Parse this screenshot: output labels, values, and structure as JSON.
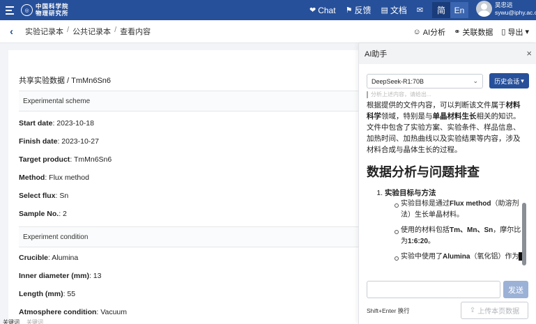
{
  "header": {
    "logo_text_line1": "中国科学院",
    "logo_text_line2": "物理研究所",
    "nav": [
      {
        "icon": "chat-icon",
        "glyph": "❤",
        "label": "Chat"
      },
      {
        "icon": "feedback-icon",
        "glyph": "⚑",
        "label": "反馈"
      },
      {
        "icon": "document-icon",
        "glyph": "▤",
        "label": "文档"
      },
      {
        "icon": "mail-icon",
        "glyph": "✉",
        "label": ""
      }
    ],
    "lang_simplified": "简",
    "lang_english": "En",
    "user_name": "吴忠远",
    "user_email": "sywu@iphy.ac.c"
  },
  "breadcrumb": {
    "items": [
      "实验记录本",
      "公共记录本",
      "查看内容"
    ],
    "separator": "/"
  },
  "actions": {
    "ai_analysis": "AI分析",
    "link_data": "关联数据",
    "export": "导出"
  },
  "document": {
    "title": "共享实验数据 / TmMn6Sn6",
    "section1": "Experimental scheme",
    "fields1": [
      {
        "label": "Start date",
        "value": ": 2023-10-18"
      },
      {
        "label": "Finish date",
        "value": ": 2023-10-27"
      },
      {
        "label": "Target product",
        "value": ": TmMn6Sn6"
      },
      {
        "label": "Method",
        "value": ": Flux method"
      },
      {
        "label": "Select flux",
        "value": ": Sn"
      },
      {
        "label": "Sample No.",
        "value": ": 2"
      }
    ],
    "section2": "Experiment condition",
    "fields2": [
      {
        "label": "Crucible",
        "value": ": Alumina"
      },
      {
        "label": "Inner diameter (mm)",
        "value": ": 13"
      },
      {
        "label": "Length (mm)",
        "value": ": 55"
      },
      {
        "label": "Atmosphere condition",
        "value": ": Vacuum"
      }
    ]
  },
  "bottom_tabs": [
    "关键词",
    "关键词"
  ],
  "ai_panel": {
    "title": "AI助手",
    "close": "×",
    "model": "DeepSeek-R1:70B",
    "history_button": "历史会话",
    "quote_text": "分析上述内容，请给出...",
    "intro_parts": [
      "根据提供的文件内容，可以判断该文件属于",
      "材料科学",
      "领域，特别是与",
      "单晶材料生长",
      "相关的知识。文件中包含了实验方案、实验条件、样品信息、加热时间、加热曲线以及实验结果等内容，涉及材料合成与晶体生长的过程。"
    ],
    "heading": "数据分析与问题排查",
    "list_title": "实验目标与方法",
    "bullets": [
      [
        "实验目标是通过",
        "Flux method",
        "（助溶剂法）生长单晶材料。"
      ],
      [
        "使用的材料包括",
        "Tm、Mn、Sn",
        "，摩尔比为",
        "1:6:20",
        "。"
      ],
      [
        "实验中使用了",
        "Alumina",
        "（氧化铝）作为"
      ]
    ],
    "send_button": "发送",
    "hint": "Shift+Enter 换行",
    "upload_button": "上传本页数据"
  }
}
